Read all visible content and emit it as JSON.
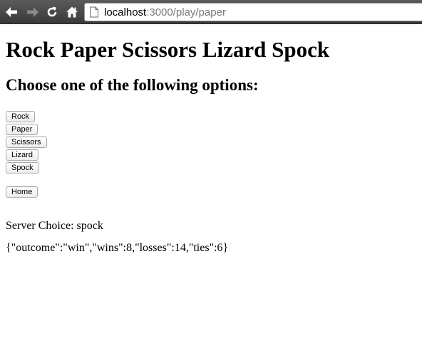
{
  "browser": {
    "url_host": "localhost",
    "url_rest": ":3000/play/paper"
  },
  "page": {
    "title": "Rock Paper Scissors Lizard Spock",
    "subtitle": "Choose one of the following options:",
    "options": [
      "Rock",
      "Paper",
      "Scissors",
      "Lizard",
      "Spock"
    ],
    "home_label": "Home",
    "server_choice_label": "Server Choice: ",
    "server_choice_value": "spock",
    "result_json": "{\"outcome\":\"win\",\"wins\":8,\"losses\":14,\"ties\":6}"
  },
  "colors": {
    "toolbar": "#3f3f3f",
    "url_host": "#000000",
    "url_rest": "#7a7a7a"
  },
  "icons": {
    "back": "arrow-left-icon",
    "forward": "arrow-right-icon",
    "reload": "reload-icon",
    "home": "home-icon",
    "page": "page-icon"
  }
}
